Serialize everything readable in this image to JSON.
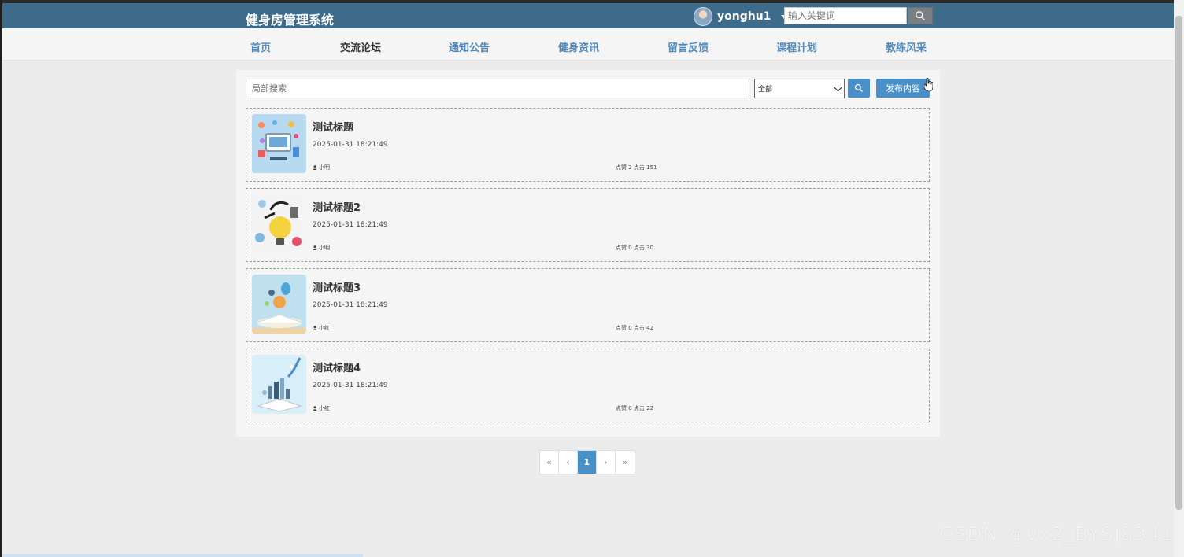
{
  "header": {
    "brand": "健身房管理系统",
    "username": "yonghu1",
    "search_placeholder": "输入关键词"
  },
  "nav": {
    "items": [
      {
        "label": "首页",
        "active": false
      },
      {
        "label": "交流论坛",
        "active": true
      },
      {
        "label": "通知公告",
        "active": false
      },
      {
        "label": "健身资讯",
        "active": false
      },
      {
        "label": "留言反馈",
        "active": false
      },
      {
        "label": "课程计划",
        "active": false
      },
      {
        "label": "教练风采",
        "active": false
      }
    ]
  },
  "toolbar": {
    "search_placeholder": "局部搜索",
    "category_selected": "全部",
    "publish_label": "发布内容"
  },
  "posts": [
    {
      "title": "测试标题",
      "date": "2025-01-31 18:21:49",
      "author": "小明",
      "stats": "点赞 2 点击 151",
      "image": "tech-illustration"
    },
    {
      "title": "测试标题2",
      "date": "2025-01-31 18:21:49",
      "author": "小明",
      "stats": "点赞 0 点击 30",
      "image": "learn-illustration"
    },
    {
      "title": "测试标题3",
      "date": "2025-01-31 18:21:49",
      "author": "小红",
      "stats": "点赞 0 点击 42",
      "image": "book-balloon-illustration"
    },
    {
      "title": "测试标题4",
      "date": "2025-01-31 18:21:49",
      "author": "小红",
      "stats": "点赞 0 点击 22",
      "image": "book-city-illustration"
    }
  ],
  "pagination": {
    "first": "«",
    "prev": "‹",
    "current": "1",
    "next": "›",
    "last": "»"
  },
  "watermark": "CSDN @vx2_BYSJ8341",
  "colors": {
    "header_bg": "#3e6b8a",
    "accent": "#4a90c8",
    "nav_text": "#4f88b8"
  }
}
